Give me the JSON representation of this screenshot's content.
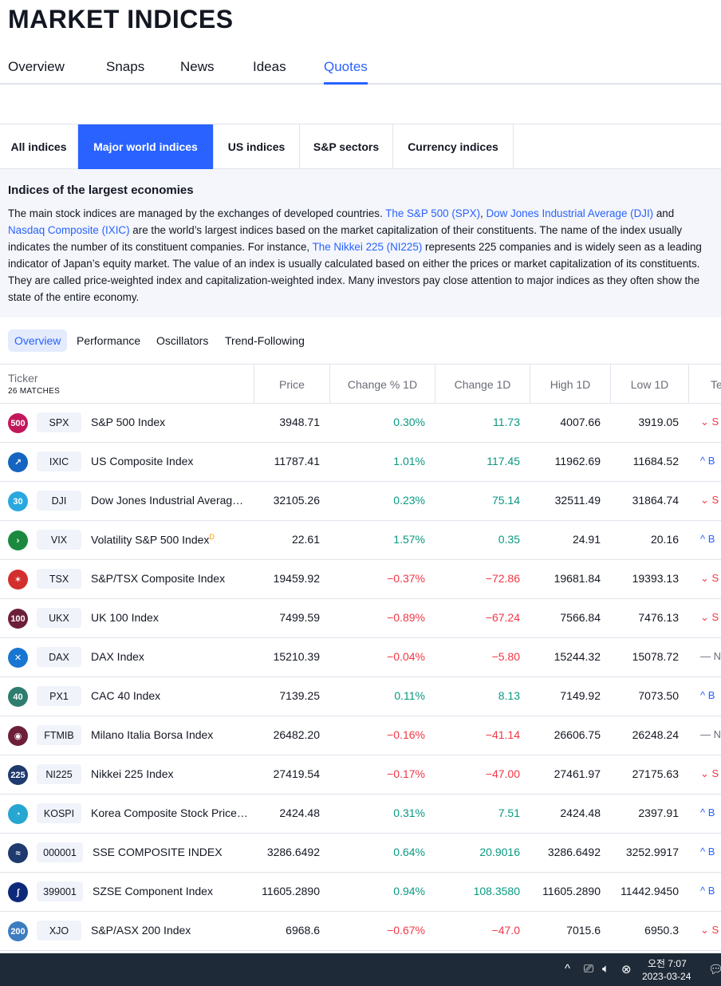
{
  "page": {
    "title": "MARKET INDICES"
  },
  "main_tabs": [
    "Overview",
    "Snaps",
    "News",
    "Ideas",
    "Quotes"
  ],
  "category_tabs": [
    "All indices",
    "Major world indices",
    "US indices",
    "S&P sectors",
    "Currency indices"
  ],
  "description": {
    "heading": "Indices of the largest economies",
    "text_1": "The main stock indices are managed by the exchanges of developed countries. ",
    "link_spx": "The S&P 500 (SPX)",
    "text_2": ", ",
    "link_dji": "Dow Jones Industrial Average (DJI)",
    "text_3": " and ",
    "link_ixic": "Nasdaq Composite (IXIC)",
    "text_4": " are the world’s largest indices based on the market capitalization of their constituents. The name of the index usually indicates the number of its constituent companies. For instance, ",
    "link_ni225": "The Nikkei 225 (NI225)",
    "text_5": " represents 225 companies and is widely seen as a leading indicator of Japan’s equity market. The value of an index is usually calculated based on either the prices or market capitalization of its constituents. They are called price-weighted index and capitalization-weighted index. Many investors pay close attention to major indices as they often show the state of the entire economy."
  },
  "sub_tabs": [
    "Overview",
    "Performance",
    "Oscillators",
    "Trend-Following"
  ],
  "table": {
    "headers": {
      "ticker": "Ticker",
      "matches": "26 MATCHES",
      "price": "Price",
      "change_pct": "Change % 1D",
      "change": "Change 1D",
      "high": "High 1D",
      "low": "Low 1D",
      "tech": "Te"
    },
    "rows": [
      {
        "logo": "500",
        "logo_color": "#c2185b",
        "symbol": "SPX",
        "name": "S&P 500 Index",
        "price": "3948.71",
        "change_pct": "0.30%",
        "change": "11.73",
        "high": "4007.66",
        "low": "3919.05",
        "tech_icon": "chevron-down-icon",
        "tech_glyph": "⌄",
        "tech": "S",
        "dir": "pos",
        "tech_class": "sell"
      },
      {
        "logo": "↗",
        "logo_color": "#1565c0",
        "symbol": "IXIC",
        "name": "US Composite Index",
        "price": "11787.41",
        "change_pct": "1.01%",
        "change": "117.45",
        "high": "11962.69",
        "low": "11684.52",
        "tech_icon": "chevron-up-icon",
        "tech_glyph": "^",
        "tech": "B",
        "dir": "pos",
        "tech_class": "buy"
      },
      {
        "logo": "30",
        "logo_color": "#29a8e0",
        "symbol": "DJI",
        "name": "Dow Jones Industrial Averag…",
        "price": "32105.26",
        "change_pct": "0.23%",
        "change": "75.14",
        "high": "32511.49",
        "low": "31864.74",
        "tech_icon": "chevron-down-icon",
        "tech_glyph": "⌄",
        "tech": "S",
        "dir": "pos",
        "tech_class": "sell"
      },
      {
        "logo": "›",
        "logo_color": "#1b8a3e",
        "symbol": "VIX",
        "name": "Volatility S&P 500 Index",
        "sup": "D",
        "price": "22.61",
        "change_pct": "1.57%",
        "change": "0.35",
        "high": "24.91",
        "low": "20.16",
        "tech_icon": "chevron-up-icon",
        "tech_glyph": "^",
        "tech": "B",
        "dir": "pos",
        "tech_class": "buy"
      },
      {
        "logo": "✶",
        "logo_color": "#d32f2f",
        "symbol": "TSX",
        "name": "S&P/TSX Composite Index",
        "price": "19459.92",
        "change_pct": "−0.37%",
        "change": "−72.86",
        "high": "19681.84",
        "low": "19393.13",
        "tech_icon": "chevron-down-icon",
        "tech_glyph": "⌄",
        "tech": "S",
        "dir": "neg",
        "tech_class": "sell"
      },
      {
        "logo": "100",
        "logo_color": "#6d1f3a",
        "symbol": "UKX",
        "name": "UK 100 Index",
        "price": "7499.59",
        "change_pct": "−0.89%",
        "change": "−67.24",
        "high": "7566.84",
        "low": "7476.13",
        "tech_icon": "chevron-down-icon",
        "tech_glyph": "⌄",
        "tech": "S",
        "dir": "neg",
        "tech_class": "sell"
      },
      {
        "logo": "✕",
        "logo_color": "#1976d2",
        "symbol": "DAX",
        "name": "DAX Index",
        "price": "15210.39",
        "change_pct": "−0.04%",
        "change": "−5.80",
        "high": "15244.32",
        "low": "15078.72",
        "tech_icon": "dash-icon",
        "tech_glyph": "—",
        "tech": "N",
        "dir": "neg",
        "tech_class": "neutral"
      },
      {
        "logo": "40",
        "logo_color": "#2e7d6f",
        "symbol": "PX1",
        "name": "CAC 40 Index",
        "price": "7139.25",
        "change_pct": "0.11%",
        "change": "8.13",
        "high": "7149.92",
        "low": "7073.50",
        "tech_icon": "chevron-up-icon",
        "tech_glyph": "^",
        "tech": "B",
        "dir": "pos",
        "tech_class": "buy"
      },
      {
        "logo": "◉",
        "logo_color": "#6d1f3a",
        "symbol": "FTMIB",
        "name": "Milano Italia Borsa Index",
        "price": "26482.20",
        "change_pct": "−0.16%",
        "change": "−41.14",
        "high": "26606.75",
        "low": "26248.24",
        "tech_icon": "dash-icon",
        "tech_glyph": "—",
        "tech": "N",
        "dir": "neg",
        "tech_class": "neutral"
      },
      {
        "logo": "225",
        "logo_color": "#1e3a6e",
        "symbol": "NI225",
        "name": "Nikkei 225 Index",
        "price": "27419.54",
        "change_pct": "−0.17%",
        "change": "−47.00",
        "high": "27461.97",
        "low": "27175.63",
        "tech_icon": "chevron-down-icon",
        "tech_glyph": "⌄",
        "tech": "S",
        "dir": "neg",
        "tech_class": "sell"
      },
      {
        "logo": "◔",
        "logo_color": "#26a6d1",
        "symbol": "KOSPI",
        "name": "Korea Composite Stock Price…",
        "price": "2424.48",
        "change_pct": "0.31%",
        "change": "7.51",
        "high": "2424.48",
        "low": "2397.91",
        "tech_icon": "chevron-up-icon",
        "tech_glyph": "^",
        "tech": "B",
        "dir": "pos",
        "tech_class": "buy"
      },
      {
        "logo": "≈",
        "logo_color": "#1e3a6e",
        "symbol": "000001",
        "name": "SSE COMPOSITE INDEX",
        "price": "3286.6492",
        "change_pct": "0.64%",
        "change": "20.9016",
        "high": "3286.6492",
        "low": "3252.9917",
        "tech_icon": "chevron-up-icon",
        "tech_glyph": "^",
        "tech": "B",
        "dir": "pos",
        "tech_class": "buy"
      },
      {
        "logo": "∫",
        "logo_color": "#0d2a7a",
        "symbol": "399001",
        "name": "SZSE Component Index",
        "price": "11605.2890",
        "change_pct": "0.94%",
        "change": "108.3580",
        "high": "11605.2890",
        "low": "11442.9450",
        "tech_icon": "chevron-up-icon",
        "tech_glyph": "^",
        "tech": "B",
        "dir": "pos",
        "tech_class": "buy"
      },
      {
        "logo": "200",
        "logo_color": "#3e7cc0",
        "symbol": "XJO",
        "name": "S&P/ASX 200 Index",
        "price": "6968.6",
        "change_pct": "−0.67%",
        "change": "−47.0",
        "high": "7015.6",
        "low": "6950.3",
        "tech_icon": "chevron-down-icon",
        "tech_glyph": "⌄",
        "tech": "S",
        "dir": "neg",
        "tech_class": "sell"
      }
    ]
  },
  "taskbar": {
    "tray_icons": [
      {
        "name": "chevron-up-icon",
        "glyph": "^"
      },
      {
        "name": "network-icon",
        "glyph": "⎚"
      },
      {
        "name": "volume-icon",
        "glyph": "🔈︎"
      },
      {
        "name": "close-circle-icon",
        "glyph": "⊗"
      }
    ],
    "time": "오전 7:07",
    "date": "2023-03-24",
    "notification_icon": "💬︎"
  }
}
